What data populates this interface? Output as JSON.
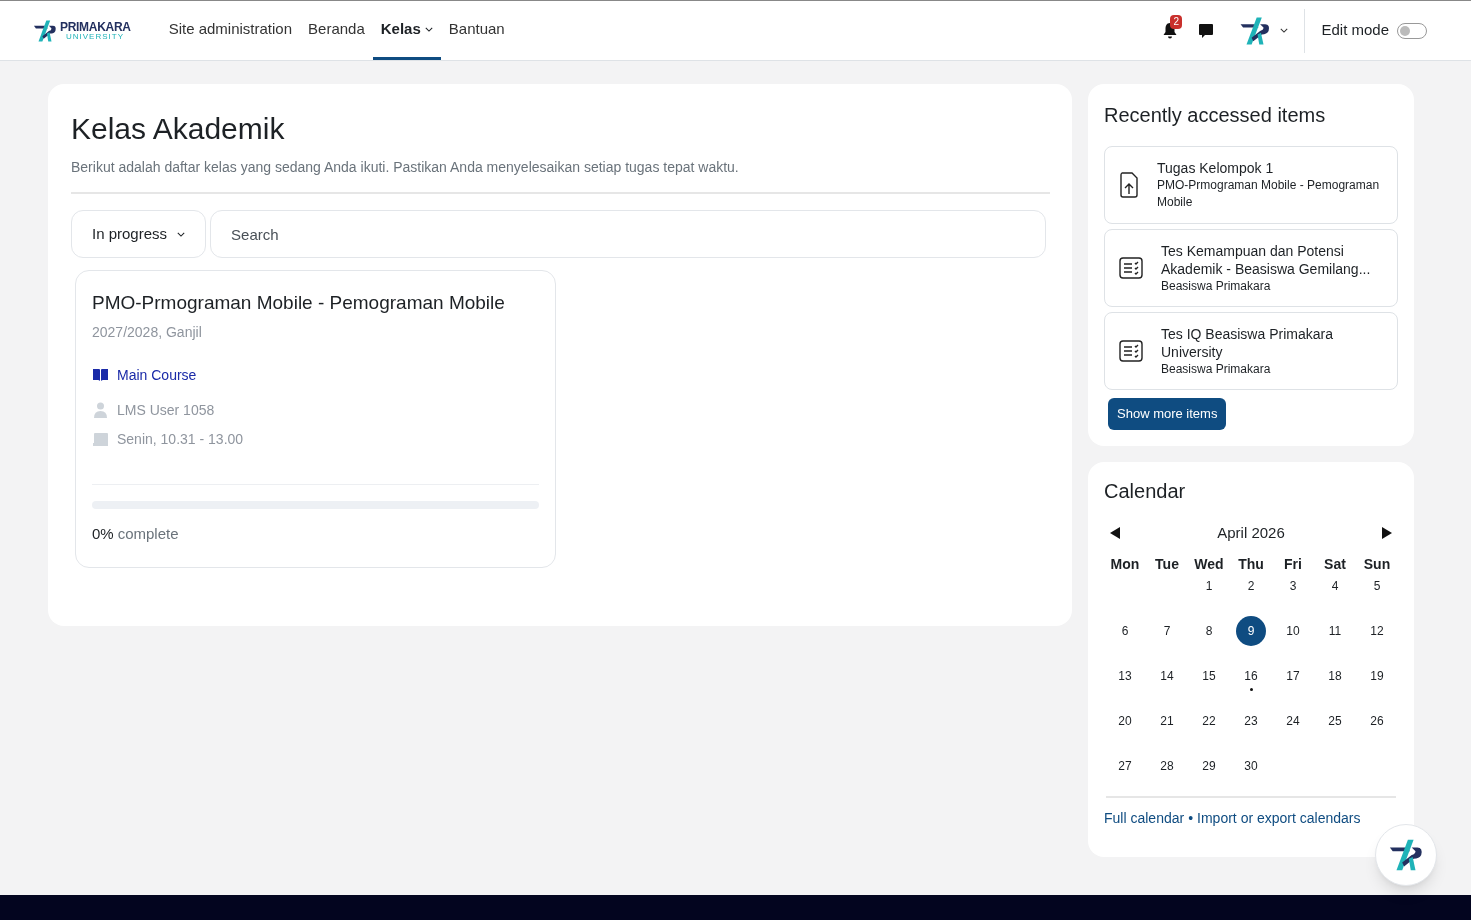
{
  "logo": {
    "name": "PRIMAKARA",
    "subtitle": "UNIVERSITY"
  },
  "nav": [
    {
      "label": "Site administration",
      "selected": false,
      "dropdown": false
    },
    {
      "label": "Beranda",
      "selected": false,
      "dropdown": false
    },
    {
      "label": "Kelas",
      "selected": true,
      "dropdown": true
    },
    {
      "label": "Bantuan",
      "selected": false,
      "dropdown": false
    }
  ],
  "notifications": {
    "count": "2"
  },
  "edit_mode": {
    "label": "Edit mode",
    "on": false
  },
  "main": {
    "title": "Kelas Akademik",
    "description": "Berikut adalah daftar kelas yang sedang Anda ikuti. Pastikan Anda menyelesaikan setiap tugas tepat waktu.",
    "filter": "In progress",
    "search": {
      "placeholder": "Search"
    },
    "courses": [
      {
        "title": "PMO-Prmograman Mobile - Pemograman Mobile",
        "term": "2027/2028, Ganjil",
        "category": "Main Course",
        "teacher": "LMS User 1058",
        "schedule": "Senin, 10.31 - 13.00",
        "level": 0,
        "progress_percent": "0%",
        "progress_label": "complete"
      }
    ]
  },
  "recent": {
    "title": "Recently accessed items",
    "items": [
      {
        "kind": "assignment",
        "title": "Tugas Kelompok 1",
        "course": "PMO-Prmograman Mobile - Pemograman Mobile"
      },
      {
        "kind": "quiz",
        "title": "Tes Kemampuan dan Potensi Akademik - Beasiswa Gemilang...",
        "course": "Beasiswa Primakara"
      },
      {
        "kind": "quiz",
        "title": "Tes IQ Beasiswa Primakara University",
        "course": "Beasiswa Primakara"
      }
    ],
    "more_button": "Show more items"
  },
  "calendar": {
    "title": "Calendar",
    "month": "April 2026",
    "weekdays": [
      "Mon",
      "Tue",
      "Wed",
      "Thu",
      "Fri",
      "Sat",
      "Sun"
    ],
    "weeks": [
      [
        {
          "label": "1",
          "selected": false,
          "event": false
        },
        {
          "label": "2",
          "selected": false,
          "event": false
        },
        {
          "label": "3",
          "selected": false,
          "event": false
        },
        {
          "label": "4",
          "selected": false,
          "event": false
        },
        {
          "label": "5",
          "selected": false,
          "event": false
        }
      ],
      [
        {
          "label": "6",
          "selected": false,
          "event": false
        },
        {
          "label": "7",
          "selected": false,
          "event": false
        },
        {
          "label": "8",
          "selected": false,
          "event": false
        },
        {
          "label": "9",
          "selected": true,
          "event": false
        },
        {
          "label": "10",
          "selected": false,
          "event": false
        },
        {
          "label": "11",
          "selected": false,
          "event": false
        },
        {
          "label": "12",
          "selected": false,
          "event": false
        }
      ],
      [
        {
          "label": "13",
          "selected": false,
          "event": false
        },
        {
          "label": "14",
          "selected": false,
          "event": false
        },
        {
          "label": "15",
          "selected": false,
          "event": false
        },
        {
          "label": "16",
          "selected": false,
          "event": true
        },
        {
          "label": "17",
          "selected": false,
          "event": false
        },
        {
          "label": "18",
          "selected": false,
          "event": false
        },
        {
          "label": "19",
          "selected": false,
          "event": false
        }
      ],
      [
        {
          "label": "20",
          "selected": false,
          "event": false
        },
        {
          "label": "21",
          "selected": false,
          "event": false
        },
        {
          "label": "22",
          "selected": false,
          "event": false
        },
        {
          "label": "23",
          "selected": false,
          "event": false
        },
        {
          "label": "24",
          "selected": false,
          "event": false
        },
        {
          "label": "25",
          "selected": false,
          "event": false
        },
        {
          "label": "26",
          "selected": false,
          "event": false
        }
      ],
      [
        {
          "label": "27",
          "selected": false,
          "event": false
        },
        {
          "label": "28",
          "selected": false,
          "event": false
        },
        {
          "label": "29",
          "selected": false,
          "event": false
        },
        {
          "label": "30",
          "selected": false,
          "event": false
        }
      ]
    ],
    "links": [
      "Full calendar",
      "Import or export calendars"
    ],
    "separator": "•"
  }
}
